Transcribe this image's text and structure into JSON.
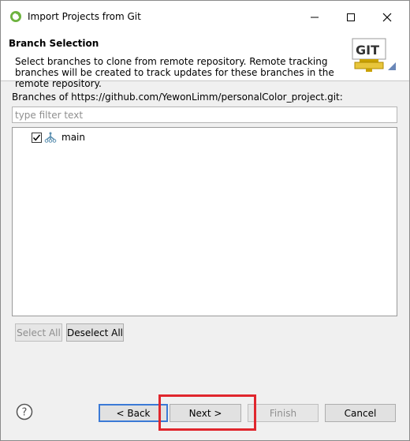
{
  "window": {
    "title": "Import Projects from Git"
  },
  "header": {
    "title": "Branch Selection",
    "description": "Select branches to clone from remote repository. Remote tracking branches will be created to track updates for these branches in the remote repository.",
    "logo_text": "GIT"
  },
  "branches": {
    "label": "Branches of https://github.com/YewonLimm/personalColor_project.git:",
    "filter_placeholder": "type filter text",
    "items": [
      {
        "label": "main",
        "checked": true
      }
    ]
  },
  "selection_buttons": {
    "select_all": "Select All",
    "deselect_all": "Deselect All"
  },
  "footer": {
    "back": "< Back",
    "next": "Next >",
    "finish": "Finish",
    "cancel": "Cancel"
  },
  "colors": {
    "highlight": "#e0262d",
    "default_button_border": "#3b7ad6"
  }
}
